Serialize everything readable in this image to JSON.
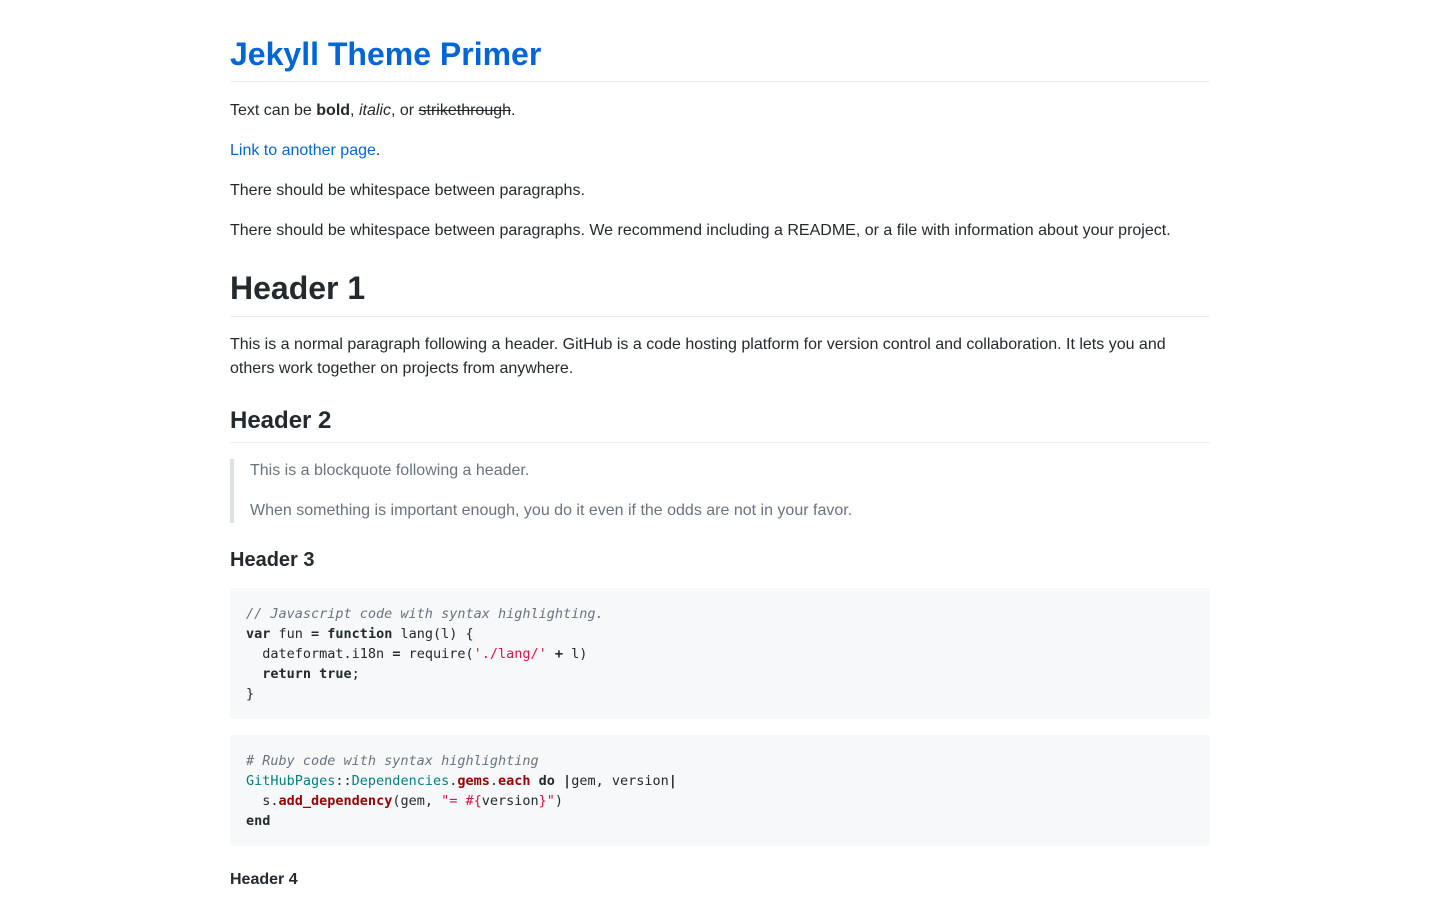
{
  "site": {
    "title": "Jekyll Theme Primer"
  },
  "intro": {
    "text_before_bold": "Text can be ",
    "bold": "bold",
    "sep1": ", ",
    "italic": "italic",
    "sep2": ", or ",
    "strike": "strikethrough",
    "end": "."
  },
  "link_paragraph": {
    "link_text": "Link to another page",
    "end": "."
  },
  "paragraph_whitespace_1": "There should be whitespace between paragraphs.",
  "paragraph_whitespace_2": "There should be whitespace between paragraphs. We recommend including a README, or a file with information about your project.",
  "header1": {
    "title": "Header 1",
    "paragraph": "This is a normal paragraph following a header. GitHub is a code hosting platform for version control and collaboration. It lets you and others work together on projects from anywhere."
  },
  "header2": {
    "title": "Header 2",
    "blockquote": [
      "This is a blockquote following a header.",
      "When something is important enough, you do it even if the odds are not in your favor."
    ]
  },
  "header3": {
    "title": "Header 3"
  },
  "code_js": {
    "comment": "// Javascript code with syntax highlighting.",
    "var_kw": "var",
    "fun_name": " fun ",
    "eq": "=",
    "function_kw": " function",
    "sig": " lang(l) {",
    "line2_start": "  dateformat.i18n ",
    "line2_eq": "=",
    "line2_req": " require(",
    "line2_str": "'./lang/'",
    "line2_plus": " + ",
    "line2_end": "l)",
    "return_kw": "  return",
    "true_kw": " true",
    "semi": ";",
    "close": "}"
  },
  "code_ruby": {
    "comment": "# Ruby code with syntax highlighting",
    "cls1": "GitHubPages",
    "sep": "::",
    "cls2": "Dependencies",
    "dot1": ".",
    "gems": "gems",
    "dot2": ".",
    "each": "each",
    "do_kw": " do",
    "pipe_open": " |",
    "args": "gem, version",
    "pipe_close": "|",
    "line2_s": "  s",
    "line2_dot": ".",
    "add_dep": "add_dependency",
    "line2_args": "(gem, ",
    "line2_str_open": "\"= #{",
    "line2_var": "version",
    "line2_str_close": "}\"",
    "line2_end": ")",
    "end_kw": "end"
  },
  "header4": {
    "title": "Header 4"
  }
}
